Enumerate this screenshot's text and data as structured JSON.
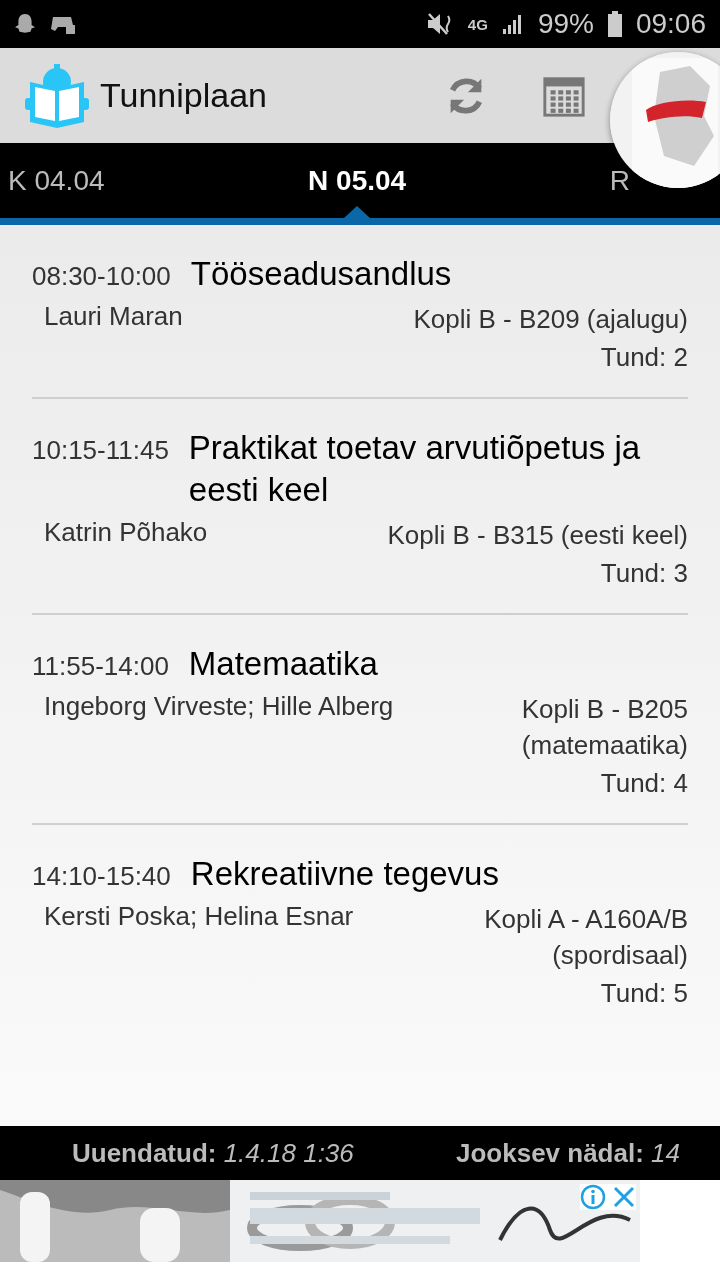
{
  "status_bar": {
    "network": "4G",
    "battery": "99%",
    "time": "09:06"
  },
  "app_bar": {
    "title": "Tunniplaan"
  },
  "tabs": [
    {
      "label": "K 04.04",
      "selected": false
    },
    {
      "label": "N 05.04",
      "selected": true
    },
    {
      "label": "R",
      "selected": false
    }
  ],
  "lessons": [
    {
      "time": "08:30-10:00",
      "subject": "Tööseadusandlus",
      "teacher": "Lauri Maran",
      "room": "Kopli B - B209 (ajalugu)",
      "period": "Tund: 2"
    },
    {
      "time": "10:15-11:45",
      "subject": "Praktikat toetav arvutiõpetus ja eesti keel",
      "teacher": "Katrin Põhako",
      "room": "Kopli B - B315 (eesti keel)",
      "period": "Tund: 3"
    },
    {
      "time": "11:55-14:00",
      "subject": "Matemaatika",
      "teacher": "Ingeborg Virveste; Hille Alberg",
      "room": "Kopli B - B205 (matemaatika)",
      "period": "Tund: 4"
    },
    {
      "time": "14:10-15:40",
      "subject": "Rekreatiivne tegevus",
      "teacher": "Kersti Poska; Helina Esnar",
      "room": "Kopli A - A160A/B (spordisaal)",
      "period": "Tund: 5"
    }
  ],
  "footer": {
    "updated_label": "Uuendatud:",
    "updated_value": "1.4.18 1:36",
    "week_label": "Jooksev nädal:",
    "week_value": "14"
  }
}
